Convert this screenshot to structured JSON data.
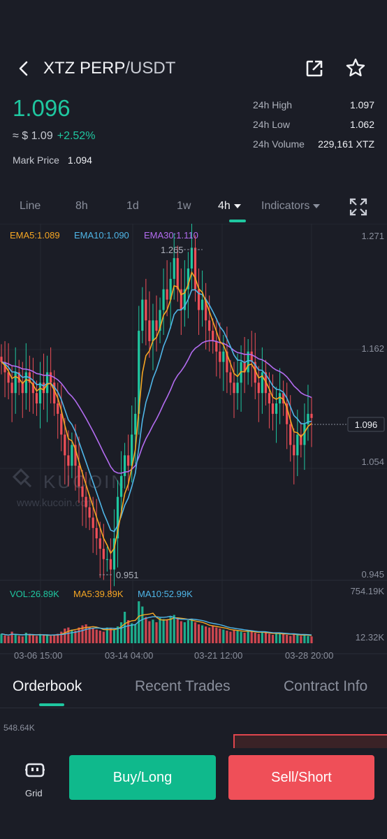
{
  "header": {
    "pair_base": "XTZ PERP",
    "pair_quote": "/USDT"
  },
  "ticker": {
    "last_price": "1.096",
    "approx_usd": "≈ $ 1.09",
    "change": "+2.52%",
    "mark_label": "Mark Price",
    "mark_value": "1.094",
    "high_label": "24h High",
    "high_value": "1.097",
    "low_label": "24h Low",
    "low_value": "1.062",
    "volume_label": "24h Volume",
    "volume_value": "229,161 XTZ"
  },
  "timeframe_tabs": [
    {
      "label": "Line"
    },
    {
      "label": "8h"
    },
    {
      "label": "1d"
    },
    {
      "label": "1w"
    },
    {
      "label": "4h",
      "active": true
    },
    {
      "label": "Indicators"
    }
  ],
  "chart_data": {
    "type": "candlestick",
    "ema_labels": [
      "EMA5:1.089",
      "EMA10:1.090",
      "EMA30:1.110"
    ],
    "y_ticks": [
      "1.271",
      "1.162",
      "1.054",
      "0.945"
    ],
    "high_marker": "1.265",
    "low_marker": "0.951",
    "current_price_tag": "1.096",
    "volume_labels": [
      "VOL:26.89K",
      "MA5:39.89K",
      "MA10:52.99K"
    ],
    "volume_ticks": [
      "754.19K",
      "12.32K"
    ],
    "x_ticks": [
      "03-06 15:00",
      "03-14 04:00",
      "03-21 12:00",
      "03-28 20:00"
    ],
    "watermark": "KUCOIN",
    "watermark_url": "www.kucoin.com",
    "colors": {
      "up": "#1fc7a0",
      "down": "#ef4f58",
      "ema5": "#f5a623",
      "ema10": "#4fb6e8",
      "ema30": "#b36cf0"
    },
    "close_series": [
      1.15,
      1.14,
      1.13,
      1.12,
      1.14,
      1.13,
      1.12,
      1.14,
      1.13,
      1.12,
      1.11,
      1.13,
      1.12,
      1.14,
      1.13,
      1.11,
      1.1,
      1.08,
      1.06,
      1.05,
      1.07,
      1.05,
      1.03,
      1.02,
      1.01,
      1.0,
      0.99,
      0.98,
      0.97,
      0.96,
      0.96,
      0.95,
      0.98,
      1.02,
      1.04,
      1.06,
      1.05,
      1.08,
      1.1,
      1.18,
      1.21,
      1.19,
      1.17,
      1.19,
      1.18,
      1.2,
      1.22,
      1.21,
      1.23,
      1.25,
      1.22,
      1.2,
      1.22,
      1.24,
      1.26,
      1.22,
      1.2,
      1.21,
      1.19,
      1.18,
      1.17,
      1.16,
      1.15,
      1.16,
      1.14,
      1.13,
      1.12,
      1.13,
      1.15,
      1.14,
      1.16,
      1.15,
      1.13,
      1.12,
      1.14,
      1.12,
      1.11,
      1.1,
      1.11,
      1.12,
      1.11,
      1.09,
      1.07,
      1.06,
      1.08,
      1.07,
      1.09,
      1.1,
      1.096
    ],
    "volume_series": [
      18,
      15,
      14,
      22,
      16,
      14,
      13,
      20,
      18,
      15,
      14,
      16,
      15,
      17,
      14,
      16,
      18,
      22,
      28,
      30,
      26,
      24,
      30,
      34,
      36,
      30,
      28,
      26,
      24,
      22,
      30,
      28,
      26,
      32,
      40,
      60,
      44,
      38,
      36,
      80,
      70,
      50,
      42,
      45,
      40,
      48,
      46,
      44,
      50,
      54,
      48,
      42,
      40,
      44,
      46,
      40,
      36,
      34,
      32,
      30,
      34,
      30,
      28,
      26,
      24,
      22,
      26,
      24,
      22,
      20,
      24,
      22,
      20,
      18,
      22,
      20,
      18,
      16,
      18,
      20,
      18,
      16,
      14,
      18,
      16,
      14,
      16,
      14,
      13
    ]
  },
  "bottom_tabs": [
    {
      "label": "Orderbook",
      "active": true
    },
    {
      "label": "Recent Trades"
    },
    {
      "label": "Contract Info"
    }
  ],
  "orderbook": {
    "depth_label": "548.64K"
  },
  "footer": {
    "grid_label": "Grid",
    "buy_label": "Buy/Long",
    "sell_label": "Sell/Short"
  }
}
